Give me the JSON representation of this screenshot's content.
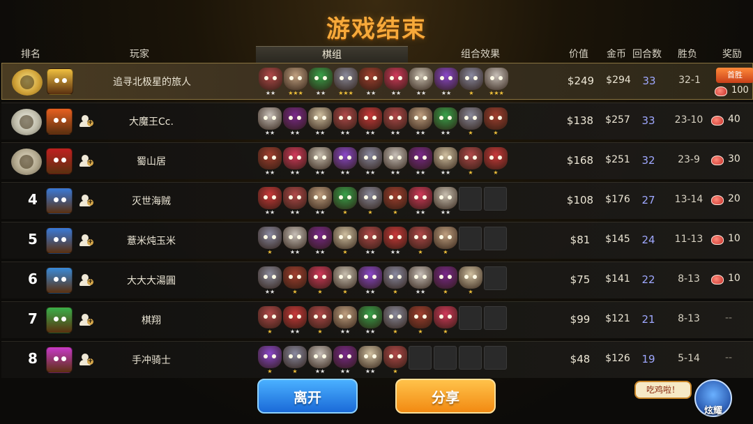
{
  "title": "游戏结束",
  "headers": {
    "rank": "排名",
    "player": "玩家",
    "board": "棋组",
    "combo": "组合效果",
    "value": "价值",
    "gold": "金币",
    "rounds": "回合数",
    "winloss": "胜负",
    "reward": "奖励"
  },
  "first_win_tag": "首胜",
  "rows": [
    {
      "rank": "1",
      "player": "追寻北极星的旅人",
      "value": "$249",
      "gold": "$294",
      "rounds": "33",
      "winloss": "32-1",
      "reward": "100"
    },
    {
      "rank": "2",
      "player": "大魔王Cc.",
      "value": "$138",
      "gold": "$257",
      "rounds": "33",
      "winloss": "23-10",
      "reward": "40"
    },
    {
      "rank": "3",
      "player": "蜀山居",
      "value": "$168",
      "gold": "$251",
      "rounds": "32",
      "winloss": "23-9",
      "reward": "30"
    },
    {
      "rank": "4",
      "player": "灭世海贼",
      "value": "$108",
      "gold": "$176",
      "rounds": "27",
      "winloss": "13-14",
      "reward": "20"
    },
    {
      "rank": "5",
      "player": "薏米炖玉米",
      "value": "$81",
      "gold": "$145",
      "rounds": "24",
      "winloss": "11-13",
      "reward": "10"
    },
    {
      "rank": "6",
      "player": "大大大湯圓",
      "value": "$75",
      "gold": "$141",
      "rounds": "22",
      "winloss": "8-13",
      "reward": "10"
    },
    {
      "rank": "7",
      "player": "棋翔",
      "value": "$99",
      "gold": "$121",
      "rounds": "21",
      "winloss": "8-13",
      "reward": "--"
    },
    {
      "rank": "8",
      "player": "手冲骑士",
      "value": "$48",
      "gold": "$126",
      "rounds": "19",
      "winloss": "5-14",
      "reward": "--"
    }
  ],
  "buttons": {
    "leave": "离开",
    "share": "分享",
    "bubble": "吃鸡啦！",
    "show_off": "炫耀"
  },
  "colors": {
    "title": "#f7a93a",
    "rounds": "#9fa8ff",
    "leave": "#1a6ad8",
    "share": "#f28a12"
  },
  "icons": {
    "rank1": "gold-laurel-badge-icon",
    "rank2": "silver-laurel-badge-icon",
    "rank3": "bronze-laurel-badge-icon",
    "friend": "add-friend-icon",
    "reward": "meat-currency-icon",
    "show_off": "hero-mascot-icon"
  },
  "stars": {
    "one": "★",
    "two": "★★",
    "three": "★★★"
  }
}
